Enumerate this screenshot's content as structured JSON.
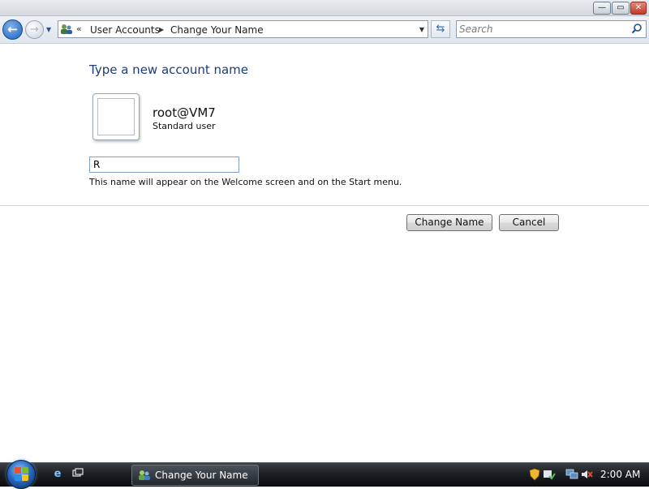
{
  "window": {
    "controls": {
      "minimize": "—",
      "maximize": "▭",
      "close": "✕"
    }
  },
  "navbar": {
    "back_glyph": "←",
    "forward_glyph": "→",
    "history_glyph": "▼",
    "address": {
      "icon": "user-accounts-icon",
      "chevron": "«",
      "breadcrumbs": [
        "User Accounts",
        "Change Your Name"
      ],
      "separator": "▶",
      "dropdown": "▼"
    },
    "refresh_glyph": "⇆",
    "search": {
      "placeholder": "Search",
      "icon": "magnifier-icon"
    }
  },
  "main": {
    "heading": "Type a new account name",
    "account": {
      "name": "root@VM7",
      "type": "Standard user"
    },
    "name_field": {
      "value": "R"
    },
    "hint": "This name will appear on the Welcome screen and on the Start menu.",
    "buttons": {
      "change_name": "Change Name",
      "cancel": "Cancel"
    }
  },
  "taskbar": {
    "task_button_label": "Change Your Name",
    "clock": "2:00 AM"
  },
  "colors": {
    "heading": "#1e3c78",
    "input_border": "#7da2ce",
    "taskbar": "#1c1f23"
  }
}
